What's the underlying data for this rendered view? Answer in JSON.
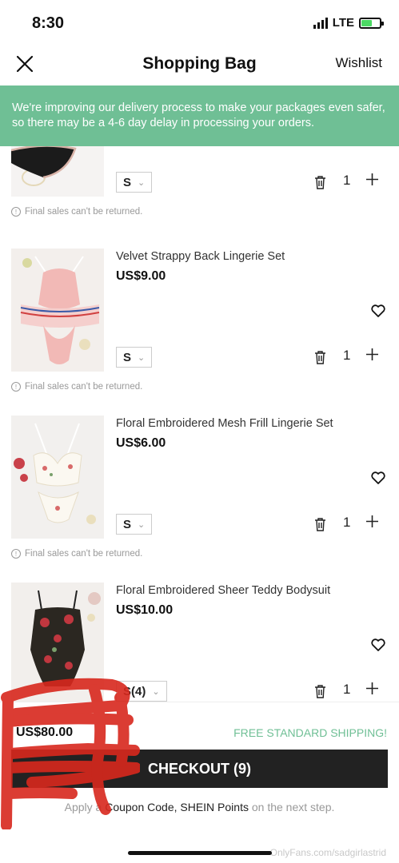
{
  "status_bar": {
    "time": "8:30",
    "network": "LTE"
  },
  "nav": {
    "title": "Shopping Bag",
    "wishlist": "Wishlist"
  },
  "banner": {
    "text": "We're improving our delivery process to make your packages even safer, so there may be a 4-6 day delay in processing your orders."
  },
  "items": [
    {
      "name": "",
      "price": "",
      "size": "S",
      "qty": "1",
      "note": "Final sales can't be returned."
    },
    {
      "name": "Velvet Strappy Back Lingerie Set",
      "price": "US$9.00",
      "size": "S",
      "qty": "1",
      "note": "Final sales can't be returned."
    },
    {
      "name": "Floral Embroidered Mesh Frill Lingerie Set",
      "price": "US$6.00",
      "size": "S",
      "qty": "1",
      "note": "Final sales can't be returned."
    },
    {
      "name": "Floral Embroidered Sheer Teddy Bodysuit",
      "price": "US$10.00",
      "size": "S(4)",
      "qty": "1",
      "note": ""
    }
  ],
  "footer": {
    "total": "US$80.00",
    "free_shipping": "FREE STANDARD SHIPPING!",
    "checkout": "CHECKOUT (9)",
    "coupon_prefix": "Apply a",
    "coupon_links": "Coupon Code, SHEIN Points",
    "coupon_suffix": "on the next step.",
    "watermark": "OnlyFans.com/sadgirlastrid"
  },
  "colors": {
    "accent_green": "#6fbf95",
    "checkout_bg": "#222222",
    "redaction": "#d8281d"
  }
}
